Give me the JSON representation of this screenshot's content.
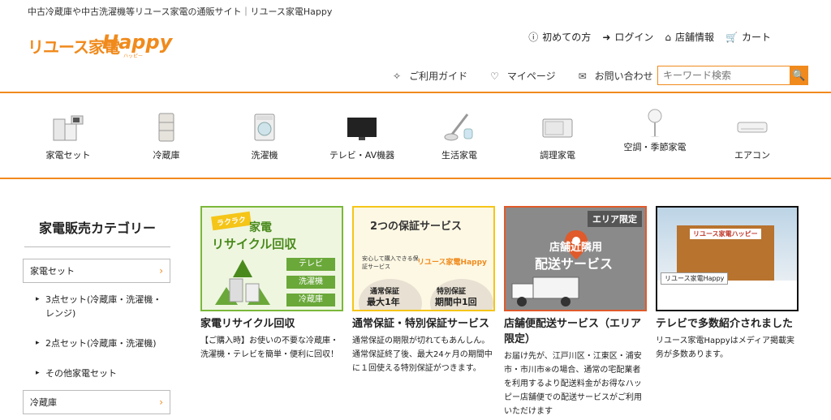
{
  "header": {
    "tagline": "中古冷蔵庫や中古洗濯機等リユース家電の通販サイト｜リユース家電Happy",
    "logo_text": "リユース家電",
    "logo_happy": "Happy",
    "logo_sub": "ハッピー",
    "top_nav": [
      {
        "icon": "info-icon",
        "label": "初めての方"
      },
      {
        "icon": "login-icon",
        "label": "ログイン"
      },
      {
        "icon": "store-icon",
        "label": "店舗情報"
      },
      {
        "icon": "cart-icon",
        "label": "カート"
      }
    ],
    "sub_nav": [
      {
        "icon": "guide-icon",
        "label": "ご利用ガイド"
      },
      {
        "icon": "heart-icon",
        "label": "マイページ"
      },
      {
        "icon": "mail-icon",
        "label": "お問い合わせ"
      }
    ],
    "search_placeholder": "キーワード検索"
  },
  "categories": [
    {
      "label": "家電セット",
      "icon": "appliance-set-icon"
    },
    {
      "label": "冷蔵庫",
      "icon": "refrigerator-icon"
    },
    {
      "label": "洗濯機",
      "icon": "washing-machine-icon"
    },
    {
      "label": "テレビ・AV機器",
      "icon": "tv-icon"
    },
    {
      "label": "生活家電",
      "icon": "vacuum-icon"
    },
    {
      "label": "調理家電",
      "icon": "microwave-icon"
    },
    {
      "label": "空調・季節家電",
      "icon": "fan-icon"
    },
    {
      "label": "エアコン",
      "icon": "air-conditioner-icon"
    }
  ],
  "sidebar": {
    "title": "家電販売カテゴリー",
    "items": [
      {
        "label": "家電セット"
      },
      {
        "label": "3点セット(冷蔵庫・洗濯機・レンジ)"
      },
      {
        "label": "2点セット(冷蔵庫・洗濯機)"
      },
      {
        "label": "その他家電セット"
      },
      {
        "label": "冷蔵庫"
      }
    ]
  },
  "cards": [
    {
      "title": "家電リサイクル回収",
      "desc": "【ご購入時】お使いの不要な冷蔵庫・洗濯機・テレビを簡単・便利に回収！",
      "img": {
        "badge": "ラクラク",
        "line1": "家電",
        "line2": "リサイクル回収",
        "tags": [
          "テレビ",
          "洗濯機",
          "冷蔵庫"
        ]
      },
      "color": "#7bb83a"
    },
    {
      "title": "通常保証・特別保証サービス",
      "desc": "通常保証の期限が切れてもあんしん。通常保証終了後、最大24ヶ月の期間中に１回使える特別保証がつきます。",
      "img": {
        "line1": "2つの保証サービス",
        "line2": "安心して購入できる保証サービス",
        "logo": "リユース家電Happy",
        "left": "通常保証",
        "left2": "最大1年",
        "right": "特別保証",
        "right2": "期間中1回"
      },
      "color": "#f5c518"
    },
    {
      "title": "店舗便配送サービス（エリア限定）",
      "desc": "お届け先が、江戸川区・江東区・浦安市・市川市※の場合、通常の宅配業者を利用するより配送料金がお得なハッピー店舗便での配送サービスがご利用いただけます",
      "img": {
        "badge": "エリア限定",
        "line1": "店舗近隣用",
        "line2": "配送サービス"
      },
      "color": "#e05a2b"
    },
    {
      "title": "テレビで多数紹介されました",
      "desc": "リユース家電Happyはメディア掲載実务が多数あります。",
      "img": {
        "caption": "リユース家電Happy",
        "sign": "リユース家電ハッピー"
      },
      "color": "#111111"
    }
  ],
  "colors": {
    "accent": "#f08a1c"
  }
}
